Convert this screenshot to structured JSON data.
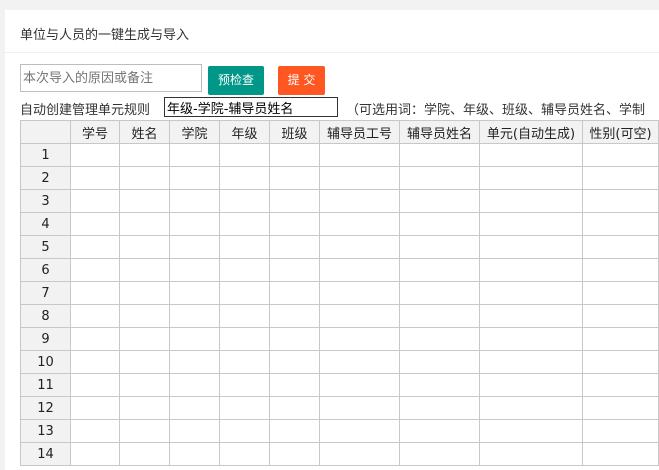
{
  "header": {
    "title": "单位与人员的一键生成与导入"
  },
  "remark": {
    "placeholder": "本次导入的原因或备注",
    "value": ""
  },
  "buttons": {
    "precheck": "预检查",
    "submit": "提 交"
  },
  "rule": {
    "label": "自动创建管理单元规则",
    "value": "年级-学院-辅导员姓名",
    "hint": "（可选用词：学院、年级、班级、辅导员姓名、学制"
  },
  "sheet": {
    "columns": [
      "学号",
      "姓名",
      "学院",
      "年级",
      "班级",
      "辅导员工号",
      "辅导员姓名",
      "单元(自动生成)",
      "性别(可空)"
    ],
    "rows": [
      "1",
      "2",
      "3",
      "4",
      "5",
      "6",
      "7",
      "8",
      "9",
      "10",
      "11",
      "12",
      "13",
      "14"
    ]
  }
}
